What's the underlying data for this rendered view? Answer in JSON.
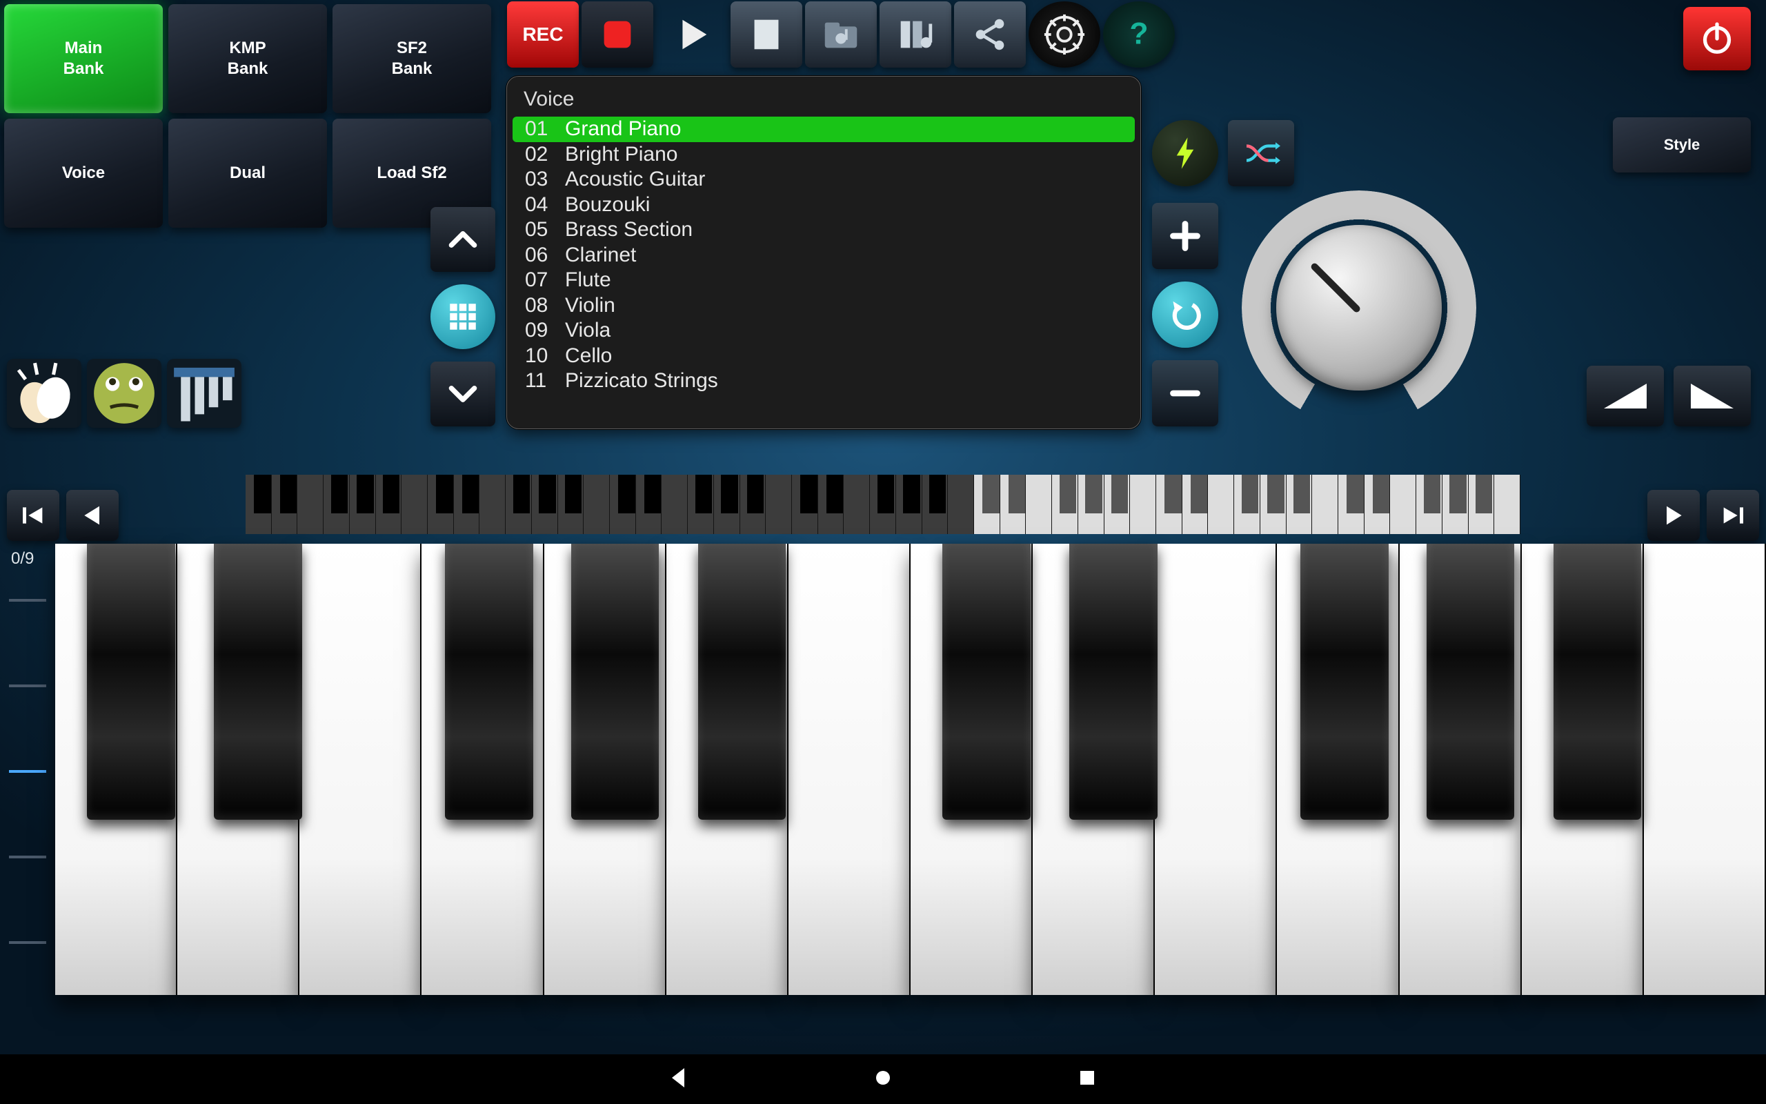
{
  "banks": [
    {
      "label": "Main\nBank",
      "active": true
    },
    {
      "label": "KMP\nBank",
      "active": false
    },
    {
      "label": "SF2\nBank",
      "active": false
    },
    {
      "label": "Voice",
      "active": false
    },
    {
      "label": "Dual",
      "active": false
    },
    {
      "label": "Load Sf2",
      "active": false
    }
  ],
  "toolbar": {
    "rec": "REC"
  },
  "voice": {
    "title": "Voice",
    "items": [
      {
        "num": "01",
        "name": "Grand Piano",
        "selected": true
      },
      {
        "num": "02",
        "name": "Bright Piano"
      },
      {
        "num": "03",
        "name": "Acoustic Guitar"
      },
      {
        "num": "04",
        "name": "Bouzouki"
      },
      {
        "num": "05",
        "name": "Brass Section"
      },
      {
        "num": "06",
        "name": "Clarinet"
      },
      {
        "num": "07",
        "name": "Flute"
      },
      {
        "num": "08",
        "name": "Violin"
      },
      {
        "num": "09",
        "name": "Viola"
      },
      {
        "num": "10",
        "name": "Cello"
      },
      {
        "num": "11",
        "name": "Pizzicato Strings"
      }
    ]
  },
  "style_label": "Style",
  "position": "0/9"
}
